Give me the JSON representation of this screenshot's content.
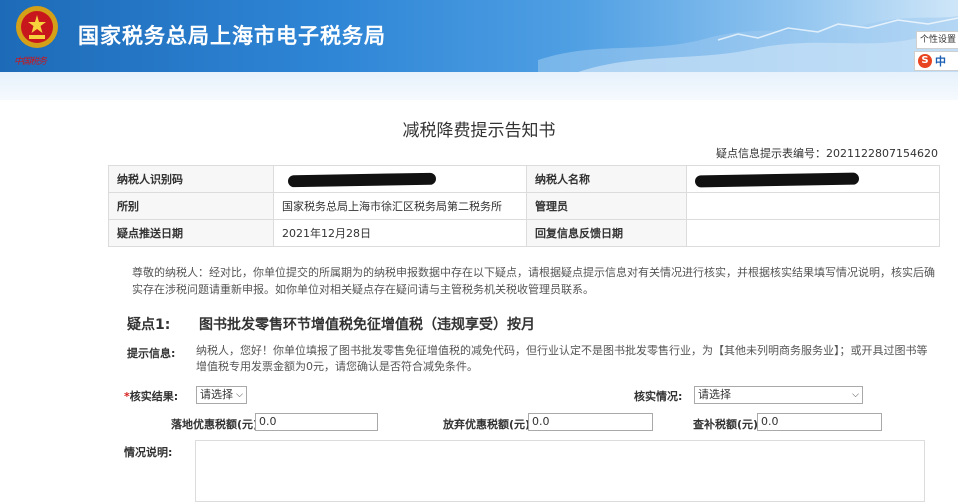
{
  "header": {
    "title": "国家税务总局上海市电子税务局",
    "brand_small": "中国税务",
    "personal_settings": "个性设置",
    "ime_logo": "S",
    "ime_label": "中"
  },
  "document": {
    "title": "减税降费提示告知书",
    "id_label": "疑点信息提示表编号：",
    "id_value": "2021122807154620",
    "table": {
      "taxpayer_id_label": "纳税人识别码",
      "taxpayer_name_label": "纳税人名称",
      "office_label": "所别",
      "office_value": "国家税务总局上海市徐汇区税务局第二税务所",
      "manager_label": "管理员",
      "push_date_label": "疑点推送日期",
      "push_date_value": "2021年12月28日",
      "reply_date_label": "回复信息反馈日期"
    },
    "notice": "尊敬的纳税人：经对比，你单位提交的所属期为的纳税申报数据中存在以下疑点，请根据疑点提示信息对有关情况进行核实，并根据核实结果填写情况说明，核实后确实存在涉税问题请重新申报。如你单位对相关疑点存在疑问请与主管税务机关税收管理员联系。"
  },
  "issue": {
    "number": "疑点1:",
    "title": "图书批发零售环节增值税免征增值税（违规享受）按月",
    "hint_label": "提示信息:",
    "hint_text": "纳税人，您好！你单位填报了图书批发零售免征增值税的减免代码，但行业认定不是图书批发零售行业，为【其他未列明商务服务业】；或开具过图书等增值税专用发票金额为0元，请您确认是否符合减免条件。",
    "verify_result_label": "核实结果:",
    "verify_result_required": "*",
    "verify_result_value": "请选择",
    "verify_status_label": "核实情况:",
    "verify_status_value": "请选择",
    "landed_amount_label": "落地优惠税额(元)",
    "landed_amount_value": "0.0",
    "waived_amount_label": "放弃优惠税额(元)",
    "waived_amount_value": "0.0",
    "supplement_amount_label": "查补税额(元)",
    "supplement_amount_value": "0.0",
    "explanation_label": "情况说明:"
  },
  "colors": {
    "header_blue": "#1d6bb8",
    "required_red": "#d6201c"
  }
}
